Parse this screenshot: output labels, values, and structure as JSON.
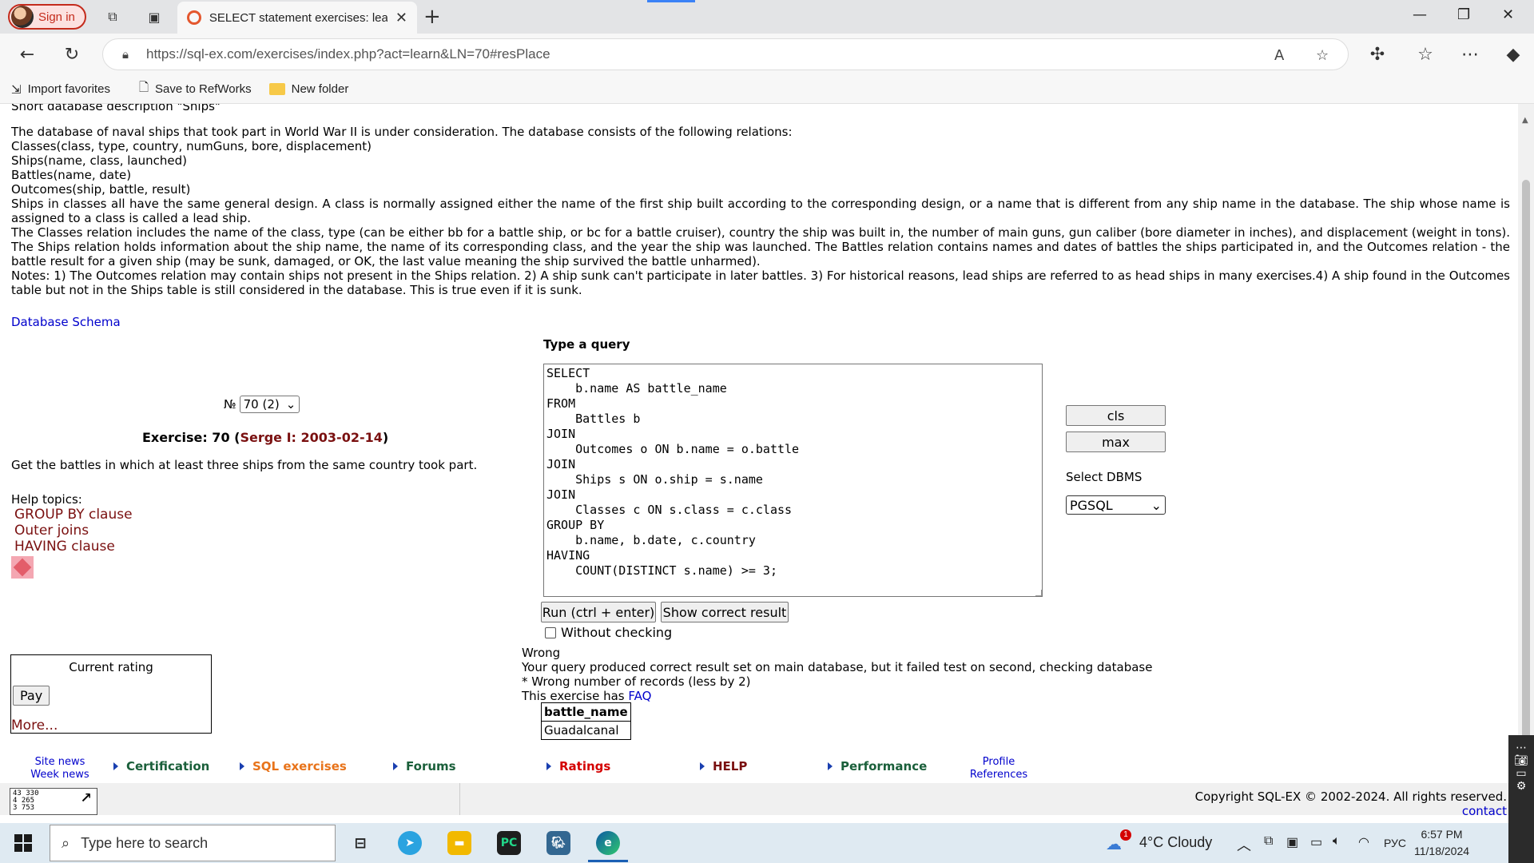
{
  "browser": {
    "signin_label": "Sign in",
    "tab_title": "SELECT statement exercises: learn",
    "url": "https://sql-ex.com/exercises/index.php?act=learn&LN=70#resPlace",
    "favorites": [
      "Import favorites",
      "Save to RefWorks",
      "New folder"
    ]
  },
  "description": {
    "head": "Short database description \"Ships\"",
    "p1": "The database of naval ships that took part in World War II is under consideration. The database consists of the following relations:",
    "r1": "Classes(class, type, country, numGuns, bore, displacement)",
    "r2": "Ships(name, class, launched)",
    "r3": "Battles(name, date)",
    "r4": "Outcomes(ship, battle, result)",
    "p2": "Ships in classes all have the same general design. A class is normally assigned either the name of the first ship built according to the corresponding design, or a name that is different from any ship name in the database. The ship whose name is assigned to a class is called a lead ship.",
    "p3": "The Classes relation includes the name of the class, type (can be either bb for a battle ship, or bc for a battle cruiser), country the ship was built in, the number of main guns, gun caliber (bore diameter in inches), and displacement (weight in tons). The Ships relation holds information about the ship name, the name of its corresponding class, and the year the ship was launched. The Battles relation contains names and dates of battles the ships participated in, and the Outcomes relation - the battle result for a given ship (may be sunk, damaged, or OK, the last value meaning the ship survived the battle unharmed).",
    "p4": "Notes: 1) The Outcomes relation may contain ships not present in the Ships relation. 2) A ship sunk can't participate in later battles. 3) For historical reasons, lead ships are referred to as head ships in many exercises.4) A ship found in the Outcomes table but not in the Ships table is still considered in the database. This is true even if it is sunk.",
    "schema_link": "Database Schema"
  },
  "exercise": {
    "no_label": "№",
    "selected": "70 (2)",
    "title_prefix": "Exercise: 70 (",
    "author": "Serge I: 2003-02-14",
    "title_suffix": ")",
    "task": "Get the battles in which at least three ships from the same country took part.",
    "help_label": "Help topics:",
    "help_topics": [
      "GROUP BY clause",
      "Outer joins",
      "HAVING clause"
    ]
  },
  "rating": {
    "title": "Current rating",
    "pay": "Pay",
    "more": "More..."
  },
  "query": {
    "title": "Type a query",
    "text": "SELECT\n    b.name AS battle_name\nFROM\n    Battles b\nJOIN\n    Outcomes o ON b.name = o.battle\nJOIN\n    Ships s ON o.ship = s.name\nJOIN\n    Classes c ON s.class = c.class\nGROUP BY\n    b.name, b.date, c.country\nHAVING\n    COUNT(DISTINCT s.name) >= 3;",
    "cls": "cls",
    "max": "max",
    "dbms_label": "Select DBMS",
    "dbms": "PGSQL",
    "run": "Run (ctrl + enter)",
    "show": "Show correct result",
    "without_checking": "Without checking"
  },
  "result": {
    "status": "Wrong",
    "msg": "Your query produced correct result set on main database, but it failed test on second, checking database",
    "detail": "* Wrong number of records (less by 2)",
    "faq_prefix": "This exercise has ",
    "faq": "FAQ",
    "column": "battle_name",
    "rows": [
      "Guadalcanal"
    ]
  },
  "menu": {
    "site_news": "Site news",
    "week_news": "Week news",
    "certification": "Certification",
    "sql_exercises": "SQL exercises",
    "forums": "Forums",
    "ratings": "Ratings",
    "help": "HELP",
    "performance": "Performance",
    "profile": "Profile",
    "references": "References"
  },
  "footer": {
    "counter": [
      "43 330",
      "4 265",
      "3 753"
    ],
    "copyright": "Copyright SQL-EX © 2002-2024. All rights reserved.",
    "contact": "contact"
  },
  "taskbar": {
    "search_placeholder": "Type here to search",
    "weather": "4°C  Cloudy",
    "weather_badge": "1",
    "lang": "РУС",
    "time": "6:57 PM",
    "date": "11/18/2024"
  },
  "colors": {
    "author": "#7a1010",
    "link": "#0000cc",
    "menu_orange": "#e8731a",
    "menu_red": "#d40000",
    "menu_green": "#1a5f3a"
  }
}
